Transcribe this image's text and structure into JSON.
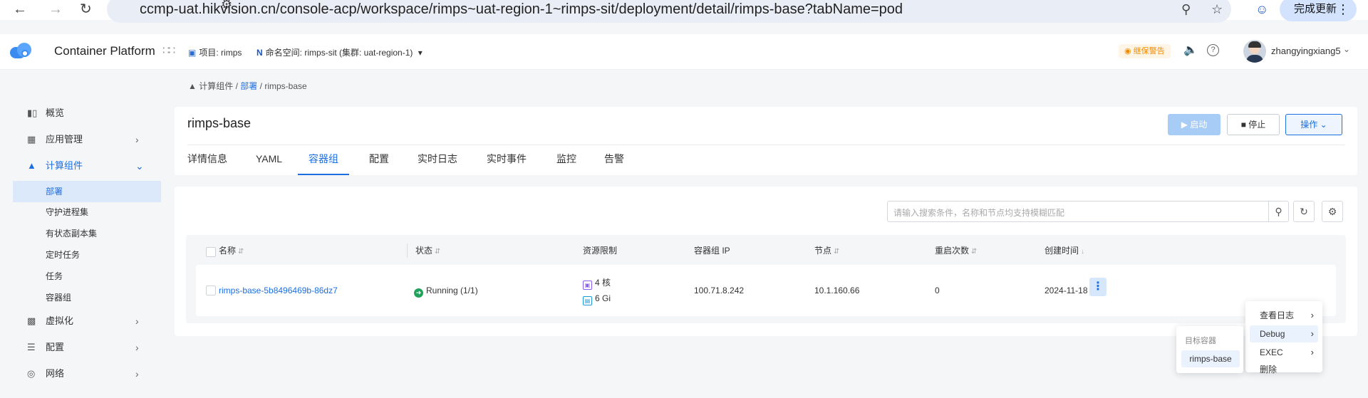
{
  "browser": {
    "url": "ccmp-uat.hikvision.cn/console-acp/workspace/rimps~uat-region-1~rimps-sit/deployment/detail/rimps-base?tabName=pod",
    "update_button": "完成更新",
    "back_icon": "back-arrow-icon",
    "forward_icon": "forward-arrow-icon",
    "reload_icon": "reload-icon"
  },
  "header": {
    "title": "Container Platform",
    "project_label": "项目:",
    "project_value": "rimps",
    "namespace_label": "命名空间:",
    "namespace_value": "rimps-sit (集群: uat-region-1)",
    "warning_badge": "继保警告",
    "username": "zhangyingxiang5"
  },
  "sidebar": {
    "items": [
      {
        "label": "概览",
        "icon": "chart-icon"
      },
      {
        "label": "应用管理",
        "icon": "apps-icon"
      },
      {
        "label": "计算组件",
        "icon": "hierarchy-icon"
      },
      {
        "label": "虚拟化",
        "icon": "virtual-icon"
      },
      {
        "label": "配置",
        "icon": "sliders-icon"
      },
      {
        "label": "网络",
        "icon": "globe-icon"
      }
    ],
    "sub_items": [
      "部署",
      "守护进程集",
      "有状态副本集",
      "定时任务",
      "任务",
      "容器组"
    ]
  },
  "breadcrumb": {
    "root": "计算组件",
    "sep": "/",
    "section": "部署",
    "current": "rimps-base"
  },
  "detail": {
    "title": "rimps-base",
    "start_label": "启动",
    "stop_label": "停止",
    "ops_label": "操作",
    "tabs": [
      "详情信息",
      "YAML",
      "容器组",
      "配置",
      "实时日志",
      "实时事件",
      "监控",
      "告警"
    ],
    "active_tab": "容器组"
  },
  "toolbar": {
    "search_placeholder": "请输入搜索条件，名称和节点均支持模糊匹配"
  },
  "table": {
    "columns": [
      "名称",
      "状态",
      "资源限制",
      "容器组 IP",
      "节点",
      "重启次数",
      "创建时间"
    ],
    "rows": [
      {
        "name": "rimps-base-5b8496469b-86dz7",
        "status": "Running (1/1)",
        "cpu": "4 核",
        "memory": "6 Gi",
        "ip": "100.71.8.242",
        "node": "10.1.160.66",
        "restarts": "0",
        "created": "2024-11-18"
      }
    ]
  },
  "row_menu": {
    "items": [
      "查看日志",
      "Debug",
      "EXEC",
      "删除"
    ],
    "highlighted": "Debug"
  },
  "debug_submenu": {
    "title": "目标容器",
    "items": [
      "rimps-base"
    ]
  },
  "colors": {
    "primary": "#1c6fe0",
    "running": "#1fa35b",
    "warning": "#f08a00"
  }
}
